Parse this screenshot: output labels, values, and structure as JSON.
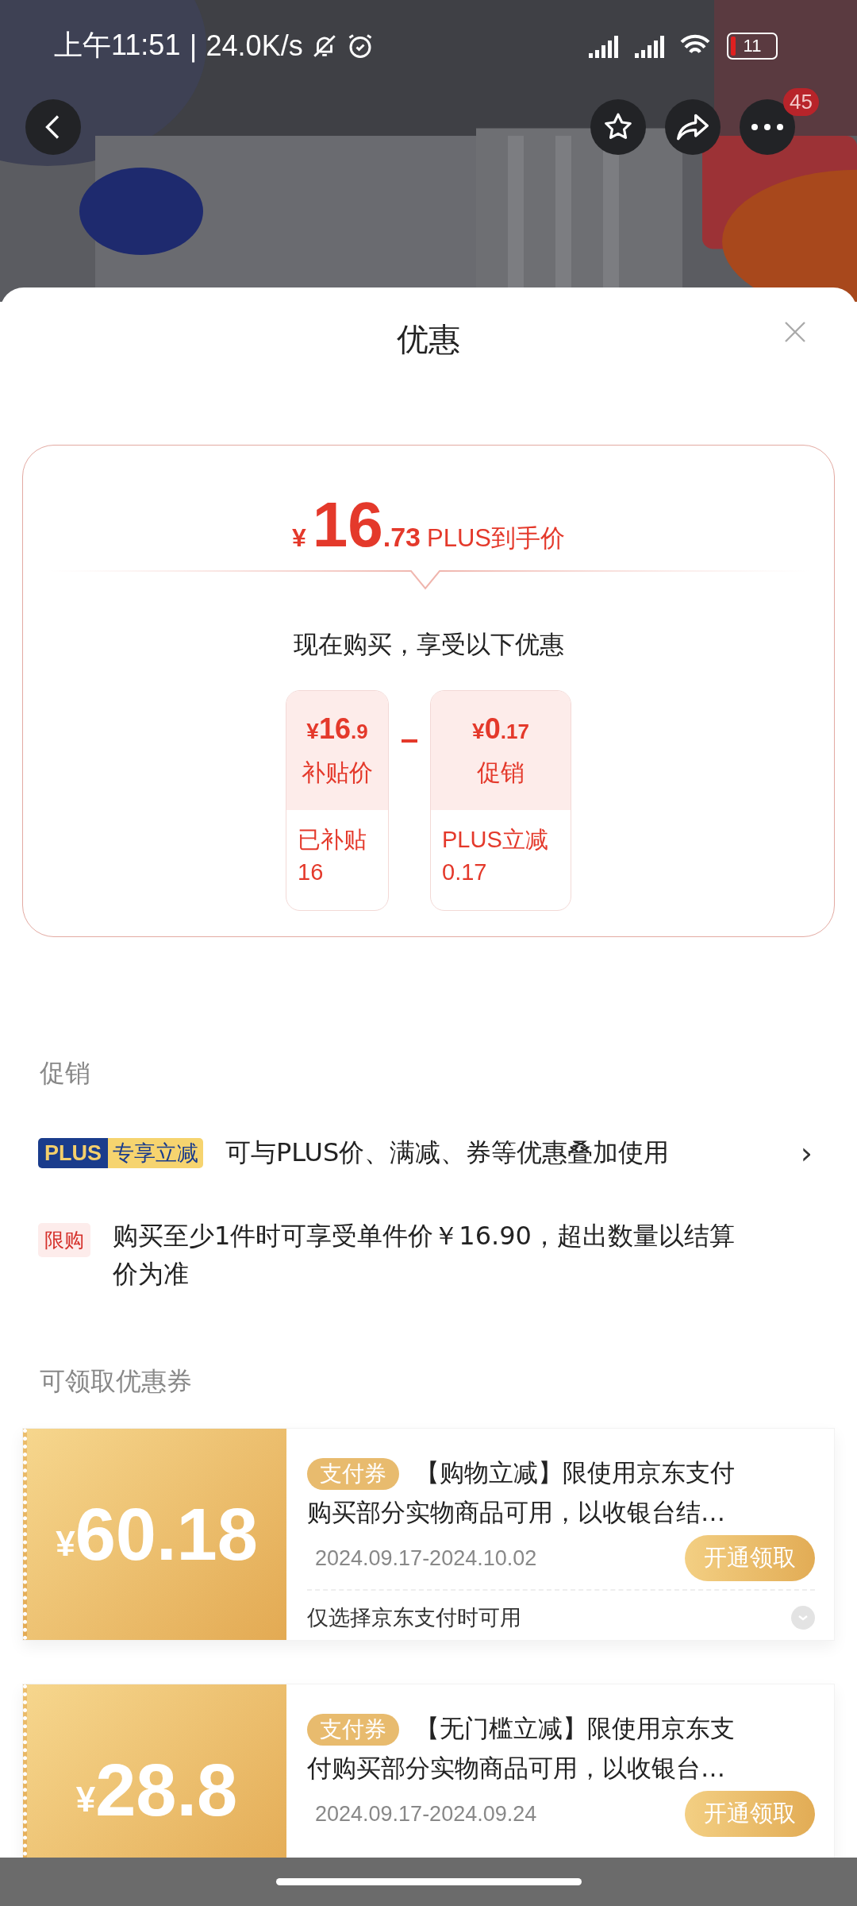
{
  "status_bar": {
    "time": "上午11:51",
    "separator": "|",
    "speed": "24.0K/s",
    "battery": "11"
  },
  "nav": {
    "badge": "45"
  },
  "sheet": {
    "title": "优惠"
  },
  "price_card": {
    "currency": "¥",
    "integer": "16",
    "decimal": ".73",
    "label": "PLUS到手价",
    "intro": "现在购买，享受以下优惠",
    "parts": [
      {
        "currency": "¥",
        "integer": "16",
        "decimal": ".9",
        "label": "补贴价",
        "note": "已补贴",
        "note_value": "16"
      },
      {
        "currency": "¥",
        "integer": "0",
        "decimal": ".17",
        "label": "促销",
        "note": "PLUS立减",
        "note_value": "0.17"
      }
    ]
  },
  "promotions": {
    "heading": "促销",
    "items": [
      {
        "kind": "plus",
        "badge_left": "PLUS",
        "badge_right": "专享立减",
        "text": "可与PLUS价、满减、券等优惠叠加使用",
        "chevron": "›"
      },
      {
        "kind": "tag",
        "badge": "限购",
        "text": "购买至少1件时可享受单件价￥16.90，超出数量以结算价为准"
      }
    ]
  },
  "coupons": {
    "heading": "可领取优惠券",
    "items": [
      {
        "currency": "¥",
        "amount": "60.18",
        "tag": "支付券",
        "title": "【购物立减】限使用京东支付购买部分实物商品可用，以收银台结…",
        "dates": "2024.09.17-2024.10.02",
        "button": "开通领取",
        "footnote": "仅选择京东支付时可用"
      },
      {
        "currency": "¥",
        "amount": "28.8",
        "tag": "支付券",
        "title": "【无门槛立减】限使用京东支付购买部分实物商品可用，以收银台…",
        "dates": "2024.09.17-2024.09.24",
        "button": "开通领取"
      }
    ]
  }
}
